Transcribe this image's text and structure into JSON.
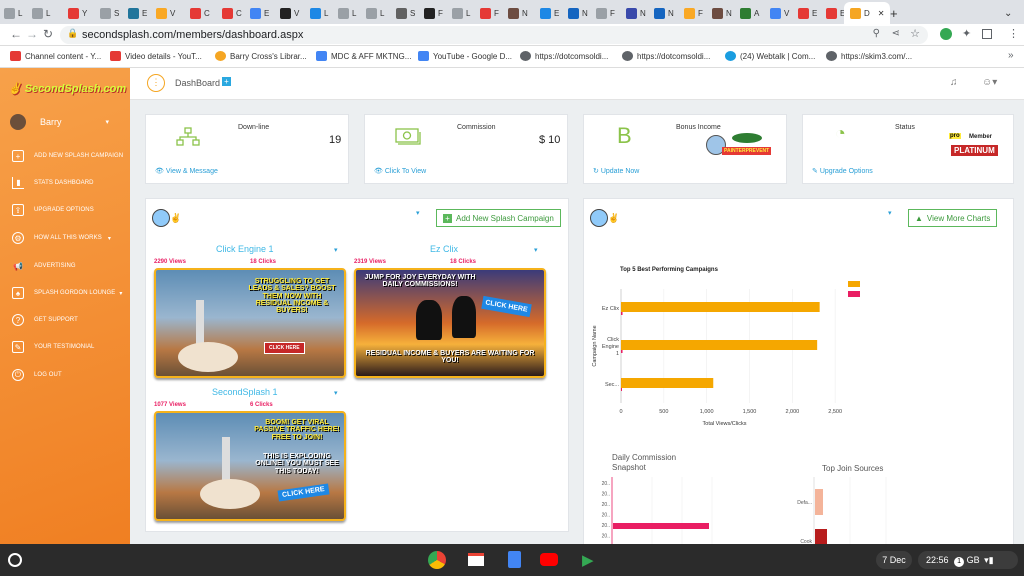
{
  "browser": {
    "url": "secondsplash.com/members/dashboard.aspx",
    "active_tab": "D",
    "bookmarks": [
      "Channel content - Y...",
      "Video details - YouT...",
      "Barry Cross's Librar...",
      "MDC & AFF MKTNG...",
      "YouTube - Google D...",
      "https://dotcomsoldi...",
      "https://dotcomsoldi...",
      "(24) Webtalk | Com...",
      "https://skim3.com/..."
    ]
  },
  "sidebar": {
    "logo": "SecondSplash.com",
    "user": "Barry",
    "items": [
      {
        "label": "ADD NEW SPLASH CAMPAIGN",
        "icon": "plus-icon"
      },
      {
        "label": "STATS DASHBOARD",
        "icon": "bar-chart-icon"
      },
      {
        "label": "UPGRADE OPTIONS",
        "icon": "upgrade-icon"
      },
      {
        "label": "HOW ALL THIS WORKS",
        "icon": "gear-icon"
      },
      {
        "label": "ADVERTISING",
        "icon": "megaphone-icon"
      },
      {
        "label": "SPLASH GORDON LOUNGE",
        "icon": "lounge-icon"
      },
      {
        "label": "GET SUPPORT",
        "icon": "support-icon"
      },
      {
        "label": "YOUR TESTIMONIAL",
        "icon": "testimonial-icon"
      },
      {
        "label": "LOG OUT",
        "icon": "logout-icon"
      }
    ]
  },
  "header": {
    "title": "DashBoard"
  },
  "stats": [
    {
      "label": "Down-line",
      "value": "19",
      "link": "View & Message"
    },
    {
      "label": "Commission",
      "value": "$ 10",
      "link": "Click To View"
    },
    {
      "label": "Bonus Income",
      "value": "",
      "link": "Update Now",
      "badge": "PAINTERPREVENT"
    },
    {
      "label": "Status",
      "value": "",
      "link": "Upgrade Options",
      "badge_top": "Member",
      "badge_pro": "pro",
      "badge_main": "PLATINUM"
    }
  ],
  "campaigns_panel": {
    "button": "Add New Splash Campaign",
    "campaigns": [
      {
        "name": "Click Engine 1",
        "views": "2290 Views",
        "clicks": "18 Clicks",
        "banner": "STRUGGLING TO GET LEADS & SALES? BOOST THEM NOW WITH RESIDUAL INCOME & BUYERS!",
        "cta": "CLICK HERE"
      },
      {
        "name": "Ez Clix",
        "views": "2319 Views",
        "clicks": "18 Clicks",
        "banner": "JUMP FOR JOY EVERYDAY WITH DAILY COMMISSIONS!",
        "banner2": "RESIDUAL INCOME & BUYERS ARE WAITING FOR YOU!",
        "cta": "CLICK HERE"
      },
      {
        "name": "SecondSplash 1",
        "views": "1077 Views",
        "clicks": "6 Clicks",
        "banner": "BOOM! GET VIRAL PASSIVE TRAFFIC HERE! FREE TO JOIN!",
        "banner2": "THIS IS EXPLODING ONLINE! YOU MUST SEE THIS TODAY!",
        "cta": "CLICK HERE"
      }
    ]
  },
  "charts_panel": {
    "button": "View More Charts",
    "daily_title": "Daily Commission Snapshot",
    "daily_ticks": [
      "20..",
      "20..",
      "20..",
      "20..",
      "20..",
      "20.."
    ],
    "sources_title": "Top Join Sources",
    "sources_labels": [
      "Defa...",
      "Cook"
    ]
  },
  "chart_data": {
    "type": "bar",
    "title": "Top 5 Best Performing Campaigns",
    "xlabel": "Total Views/Clicks",
    "ylabel": "Campaign Name",
    "categories": [
      "Ez Clix",
      "Click Engine 1",
      "Sec..."
    ],
    "series": [
      {
        "values": [
          2319,
          2290,
          1077
        ],
        "color": "#f5a700"
      },
      {
        "values": [
          18,
          18,
          6
        ],
        "color": "#e91e63"
      }
    ],
    "xticks": [
      "0",
      "500",
      "1,000",
      "1,500",
      "2,000",
      "2,500"
    ],
    "xlim": [
      0,
      2500
    ],
    "grid": true
  },
  "taskbar": {
    "date": "7 Dec",
    "time": "22:56",
    "locale": "GB",
    "badge": "1"
  }
}
